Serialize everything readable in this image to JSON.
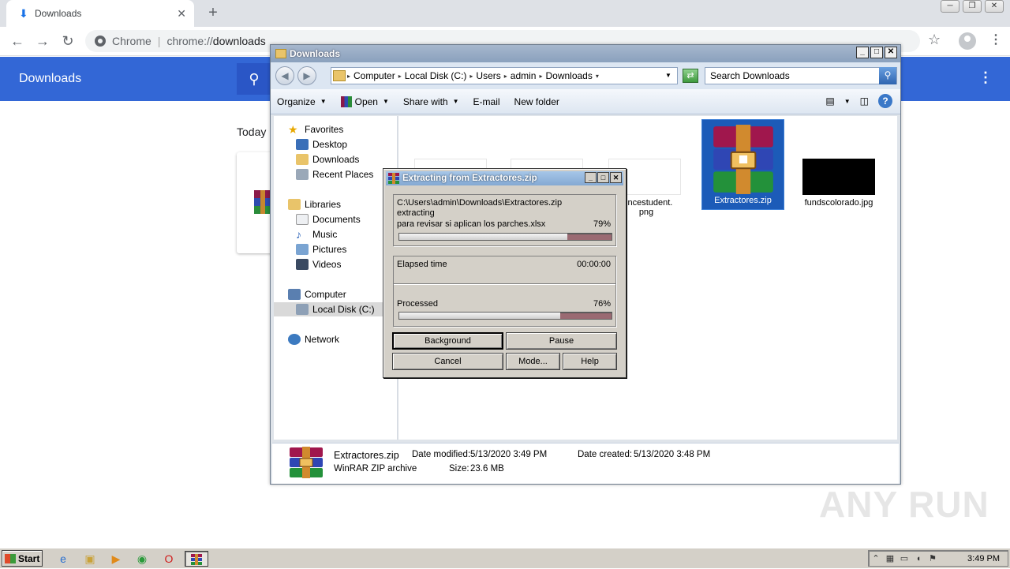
{
  "browser": {
    "tab_title": "Downloads",
    "tab_close": "✕",
    "new_tab": "+",
    "omnibox_chip": "Chrome",
    "omnibox_separator": "|",
    "url_host": "chrome://",
    "url_path": "downloads",
    "page_header_title": "Downloads",
    "section_label": "Today"
  },
  "explorer": {
    "title": "Downloads",
    "breadcrumbs": [
      "Computer",
      "Local Disk (C:)",
      "Users",
      "admin",
      "Downloads"
    ],
    "search_placeholder": "Search Downloads",
    "commands": {
      "organize": "Organize",
      "open": "Open",
      "share_with": "Share with",
      "email": "E-mail",
      "new_folder": "New folder"
    },
    "nav": {
      "favorites": "Favorites",
      "desktop": "Desktop",
      "downloads": "Downloads",
      "recent_places": "Recent Places",
      "libraries": "Libraries",
      "documents": "Documents",
      "music": "Music",
      "pictures": "Pictures",
      "videos": "Videos",
      "computer": "Computer",
      "local_disk": "Local Disk (C:)",
      "network": "Network"
    },
    "files": {
      "partial_png_line1": "rencestudent.",
      "partial_png_line2": "png",
      "zip_name": "Extractores.zip",
      "jpg_name": "fundscolorado.jpg"
    },
    "details": {
      "name": "Extractores.zip",
      "type": "WinRAR ZIP archive",
      "date_modified_label": "Date modified:",
      "date_modified": "5/13/2020 3:49 PM",
      "date_created_label": "Date created:",
      "date_created": "5/13/2020 3:48 PM",
      "size_label": "Size:",
      "size": "23.6 MB"
    }
  },
  "rar_dialog": {
    "title": "Extracting from Extractores.zip",
    "path": "C:\\Users\\admin\\Downloads\\Extractores.zip",
    "status": "extracting",
    "current_file": "para revisar si aplican los parches.xlsx",
    "file_percent_text": "79%",
    "file_progress": 0.79,
    "elapsed_label": "Elapsed time",
    "elapsed_value": "00:00:00",
    "processed_label": "Processed",
    "processed_percent_text": "76%",
    "processed_progress": 0.76,
    "buttons": {
      "background": "Background",
      "pause": "Pause",
      "cancel": "Cancel",
      "mode": "Mode...",
      "help": "Help"
    }
  },
  "watermark": "ANY  RUN",
  "taskbar": {
    "start_label": "Start",
    "clock": "3:49 PM"
  }
}
